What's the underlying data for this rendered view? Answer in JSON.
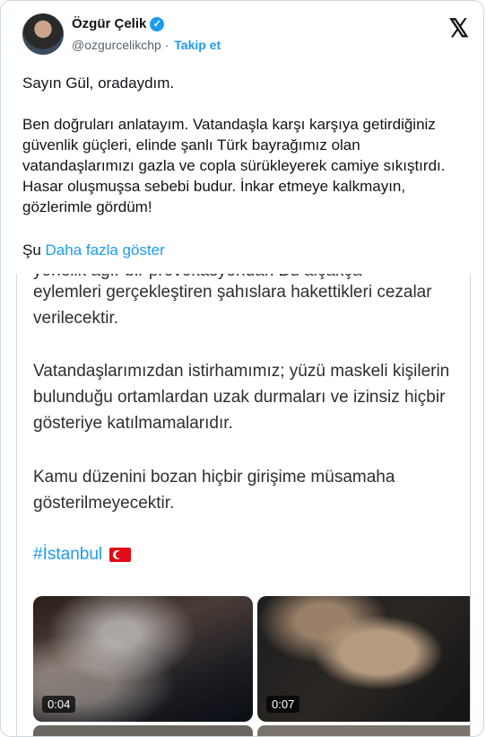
{
  "author": {
    "name": "Özgür Çelik",
    "verified_mark": "✓",
    "handle": "@ozgurcelikchp",
    "separator": "·",
    "follow_label": "Takip et"
  },
  "x_logo": "𝕏",
  "tweet": {
    "paragraphs": [
      "Sayın Gül, oradaydım.",
      "Ben doğruları anlatayım. Vatandaşla karşı karşıya getirdiğiniz güvenlik güçleri, elinde şanlı Türk bayrağımız olan vatandaşlarımızı gazla ve copla sürükleyerek camiye sıkıştırdı. Hasar oluşmuşsa sebebi budur. İnkar etmeye kalkmayın, gözlerimle gördüm!"
    ],
    "truncated_prefix": "Şu",
    "show_more": "Daha fazla göster"
  },
  "media": {
    "cut_line": "yönelik ağır bir provokasyondan Bu alçakça",
    "paragraphs": [
      "eylemleri gerçekleştiren şahıslara hakettikleri cezalar verilecektir.",
      "Vatandaşlarımızdan istirhamımız; yüzü maskeli kişilerin bulunduğu ortamlardan uzak durmaları ve izinsiz hiçbir gösteriye katılmamalarıdır.",
      "Kamu düzenini bozan hiçbir girişime müsamaha gösterilmeyecektir."
    ],
    "hashtag": "#İstanbul",
    "videos": [
      {
        "duration": "0:04"
      },
      {
        "duration": "0:07"
      }
    ]
  }
}
